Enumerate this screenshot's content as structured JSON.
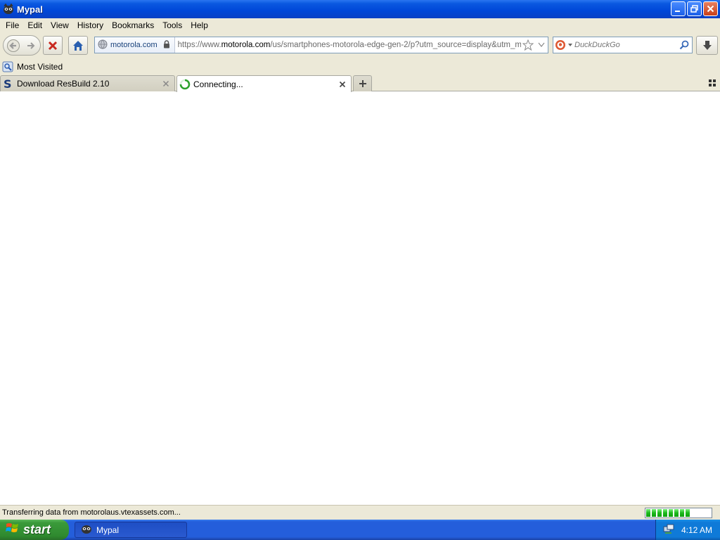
{
  "window": {
    "title": "Mypal",
    "controls": {
      "minimize": "minimize-icon",
      "restore": "restore-icon",
      "close": "close-icon"
    }
  },
  "menu": [
    "File",
    "Edit",
    "View",
    "History",
    "Bookmarks",
    "Tools",
    "Help"
  ],
  "nav": {
    "identity_label": "motorola.com",
    "url_prefix": "https://www.",
    "url_host": "motorola.com",
    "url_path": "/us/smartphones-motorola-edge-gen-2/p?utm_source=display&utm_medi",
    "search_placeholder": "DuckDuckGo"
  },
  "bookmarks": [
    {
      "label": "Most Visited",
      "icon": "bookmark-folder-icon"
    }
  ],
  "tabs": [
    {
      "label": "Download ResBuild 2.10",
      "icon": "site-s-icon",
      "active": false
    },
    {
      "label": "Connecting...",
      "icon": "loading-spinner-icon",
      "active": true
    }
  ],
  "status": {
    "text": "Transferring data from motorolaus.vtexassets.com...",
    "progress_fraction": 0.7
  },
  "taskbar": {
    "start_label": "start",
    "task_label": "Mypal",
    "clock": "4:12 AM"
  },
  "colors": {
    "titlebar": "#0047d8",
    "chrome": "#ece9d8",
    "taskbar": "#245edb",
    "start": "#3a9a3a",
    "progress": "#1cb81c"
  }
}
